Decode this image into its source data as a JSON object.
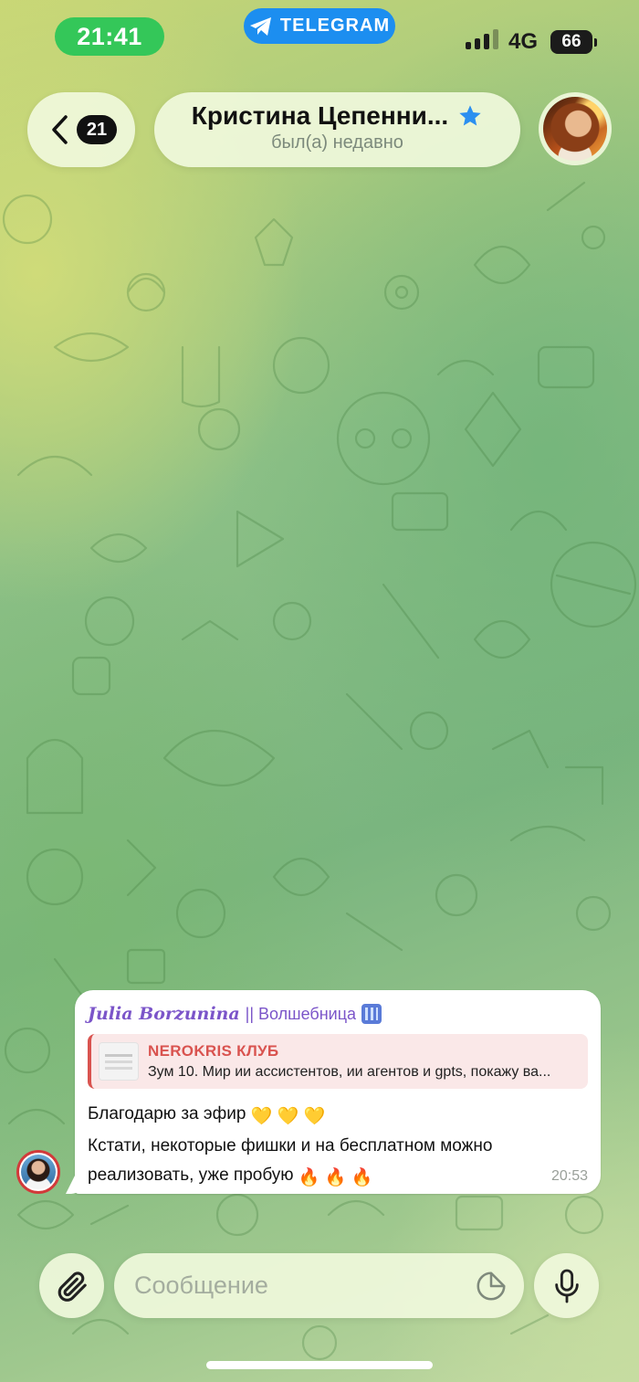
{
  "status_bar": {
    "time": "21:41",
    "app_pill": "TELEGRAM",
    "network": "4G",
    "battery": "66"
  },
  "header": {
    "unread_count": "21",
    "title": "Кристина Цепенни...",
    "status": "был(а) недавно",
    "icons": {
      "back": "chevron-left-icon",
      "verified": "star-icon"
    }
  },
  "message": {
    "sender_name": "Julia Borzunina",
    "sender_title": "|| Волшебница",
    "reply": {
      "title": "NEROKRIS КЛУБ",
      "snippet": "Зум 10. Мир ии ассистентов, ии агентов и gpts, покажу ва..."
    },
    "lines": [
      {
        "text": "Благодарю за эфир",
        "emoji": "💛 💛 💛"
      },
      {
        "text": "Кстати, некоторые фишки и на бесплатном можно",
        "emoji": ""
      },
      {
        "text": "реализовать, уже пробую",
        "emoji": "🔥 🔥 🔥"
      }
    ],
    "time": "20:53"
  },
  "input": {
    "placeholder": "Сообщение"
  },
  "colors": {
    "telegram_blue": "#1c8ef0",
    "time_pill_green": "#34c759",
    "sender_purple": "#7b55c9",
    "reply_red": "#d9534f"
  }
}
